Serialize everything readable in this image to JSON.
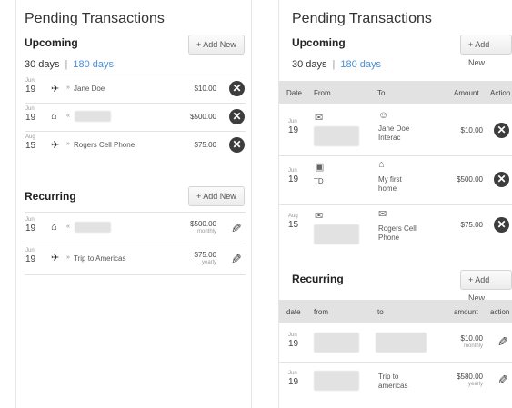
{
  "left": {
    "title": "Pending Transactions",
    "upcoming": {
      "title": "Upcoming",
      "add_label": "+ Add New",
      "range_active": "30 days",
      "range_sep": "|",
      "range_link": "180 days",
      "rows": [
        {
          "month": "Jun",
          "day": "19",
          "icon": "✈",
          "arrow": "»",
          "payee": "Jane Doe",
          "amount": "$10.00"
        },
        {
          "month": "Jun",
          "day": "19",
          "icon": "🏠",
          "arrow": "«",
          "payee": "",
          "amount": "$500.00"
        },
        {
          "month": "Aug",
          "day": "15",
          "icon": "✈",
          "arrow": "»",
          "payee": "Rogers Cell Phone",
          "amount": "$75.00"
        }
      ]
    },
    "recurring": {
      "title": "Recurring",
      "add_label": "+ Add New",
      "rows": [
        {
          "month": "Jun",
          "day": "19",
          "icon": "🏠",
          "arrow": "«",
          "payee": "",
          "amount": "$500.00",
          "freq": "monthly"
        },
        {
          "month": "Jun",
          "day": "19",
          "icon": "✈",
          "arrow": "»",
          "payee": "Trip to Americas",
          "amount": "$75.00",
          "freq": "yearly"
        }
      ]
    }
  },
  "right": {
    "title": "Pending Transactions",
    "upcoming": {
      "title": "Upcoming",
      "add_label": "+ Add New",
      "range_active": "30 days",
      "range_sep": "|",
      "range_link": "180 days",
      "headers": [
        "Date",
        "From",
        "To",
        "Amount",
        "Action"
      ],
      "rows": [
        {
          "month": "Jun",
          "day": "19",
          "from": "",
          "to_icon": "user-icon",
          "to": "Jane Doe\nInterac",
          "amount": "$10.00"
        },
        {
          "month": "Jun",
          "day": "19",
          "from": "TD",
          "to_icon": "home-icon",
          "to": "My first\nhome",
          "amount": "$500.00"
        },
        {
          "month": "Aug",
          "day": "15",
          "from": "",
          "to_icon": "envelope-icon",
          "to": "Rogers Cell\nPhone",
          "amount": "$75.00"
        }
      ]
    },
    "recurring": {
      "title": "Recurring",
      "add_label": "+ Add New",
      "headers": [
        "date",
        "from",
        "to",
        "amount",
        "action"
      ],
      "rows": [
        {
          "month": "Jun",
          "day": "19",
          "to": "",
          "amount": "$10.00",
          "freq": "monthly"
        },
        {
          "month": "Jun",
          "day": "19",
          "to": "Trip to\namericas",
          "amount": "$580.00",
          "freq": "yearly"
        }
      ]
    }
  }
}
